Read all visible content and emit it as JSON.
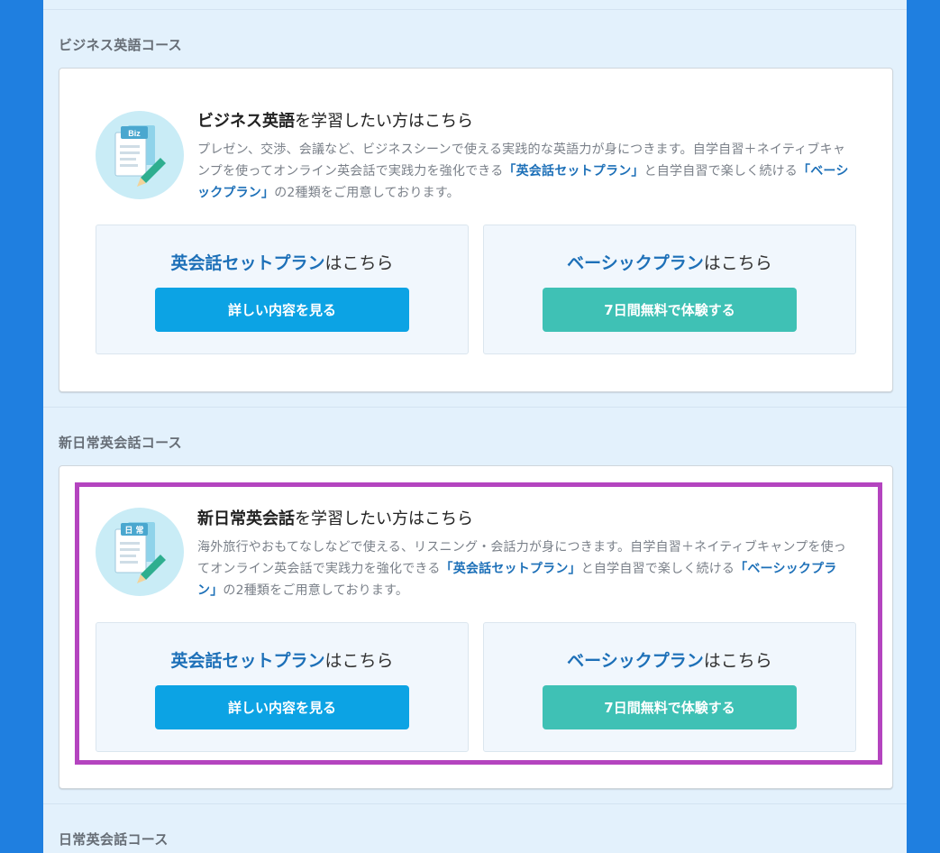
{
  "sections": [
    {
      "title": "ビジネス英語コース",
      "icon_label": "Biz",
      "heading_bold": "ビジネス英語",
      "heading_rest": "を学習したい方はこちら",
      "desc_1": "プレゼン、交渉、会議など、ビジネスシーンで使える実践的な英語力が身につきます。自学自習＋ネイティブキャンプを使ってオンライン英会話で実践力を強化できる",
      "desc_hl1": "「英会話セットプラン」",
      "desc_2": "と自学自習で楽しく続ける",
      "desc_hl2": "「ベーシックプラン」",
      "desc_3": "の2種類をご用意しております。",
      "plans": [
        {
          "title_blue": "英会話セットプラン",
          "title_rest": "はこちら",
          "button": "詳しい内容を見る"
        },
        {
          "title_blue": "ベーシックプラン",
          "title_rest": "はこちら",
          "button": "7日間無料で体験する"
        }
      ]
    },
    {
      "title": "新日常英会話コース",
      "icon_label": "日 常",
      "heading_bold": "新日常英会話",
      "heading_rest": "を学習したい方はこちら",
      "desc_1": "海外旅行やおもてなしなどで使える、リスニング・会話力が身につきます。自学自習＋ネイティブキャンプを使ってオンライン英会話で実践力を強化できる",
      "desc_hl1": "「英会話セットプラン」",
      "desc_2": "と自学自習で楽しく続ける",
      "desc_hl2": "「ベーシックプラン」",
      "desc_3": "の2種類をご用意しております。",
      "plans": [
        {
          "title_blue": "英会話セットプラン",
          "title_rest": "はこちら",
          "button": "詳しい内容を見る"
        },
        {
          "title_blue": "ベーシックプラン",
          "title_rest": "はこちら",
          "button": "7日間無料で体験する"
        }
      ]
    },
    {
      "title": "日常英会話コース"
    }
  ],
  "colors": {
    "background": "#1f7fe0",
    "page": "#e3f1fc",
    "link_blue": "#1d70b8",
    "button_blue": "#0ca3e4",
    "button_green": "#3fc1b5",
    "highlight_border": "#b444bf"
  }
}
